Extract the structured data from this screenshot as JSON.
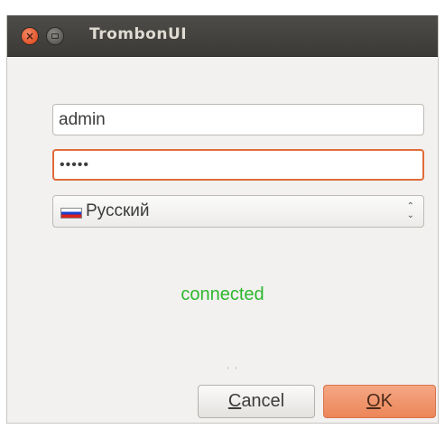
{
  "window": {
    "title": "TrombonUI"
  },
  "login": {
    "username_value": "admin",
    "password_value": "•••••",
    "language_selected": "Русский",
    "status_text": "connected"
  },
  "buttons": {
    "cancel_first": "C",
    "cancel_rest": "ancel",
    "ok_first": "O",
    "ok_rest": "K"
  },
  "colors": {
    "status_connected": "#2db82d",
    "accent": "#e06b3a",
    "titlebar": "#3b3a37"
  },
  "icons": {
    "close": "close-icon",
    "minimize": "minimize-icon",
    "flag": "russia-flag-icon",
    "spinner": "combo-arrows-icon"
  }
}
